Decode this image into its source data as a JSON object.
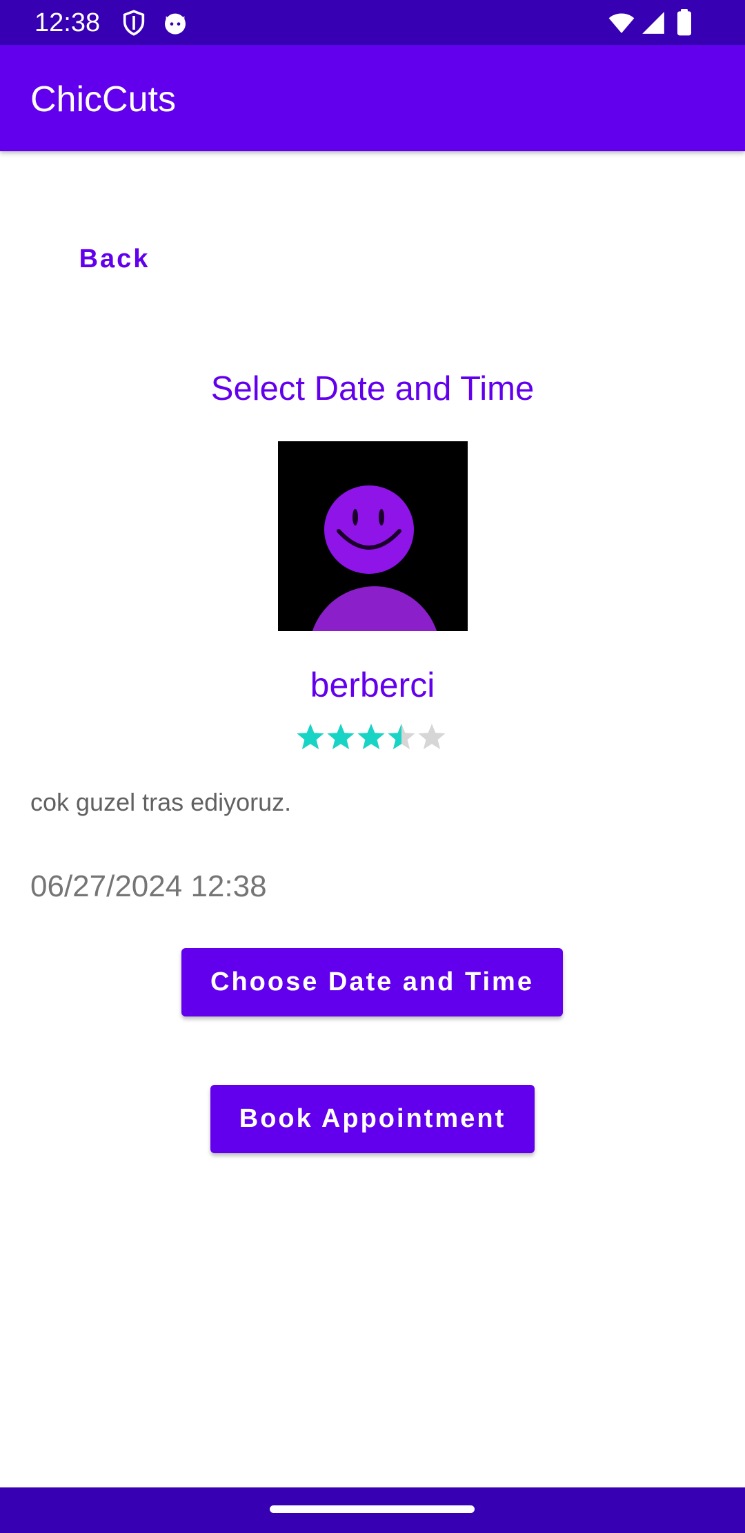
{
  "status_bar": {
    "time": "12:38",
    "icons": [
      "shield-icon",
      "cat-face-icon",
      "wifi-icon",
      "cellular-signal-icon",
      "battery-icon"
    ]
  },
  "app_bar": {
    "title": "ChicCuts"
  },
  "back_label": "Back",
  "heading": "Select Date and Time",
  "barber": {
    "avatar_icon": "smiley-person-avatar",
    "name": "berberci",
    "rating": 3.5,
    "rating_max": 5,
    "star_color": "#18D4C4",
    "star_empty_color": "#D6D6D6",
    "description": "cok guzel tras ediyoruz."
  },
  "selected_datetime": "06/27/2024 12:38",
  "buttons": {
    "choose_label": "Choose Date and Time",
    "book_label": "Book Appointment"
  },
  "colors": {
    "primary": "#6200EE",
    "primary_dark": "#3700B3"
  }
}
